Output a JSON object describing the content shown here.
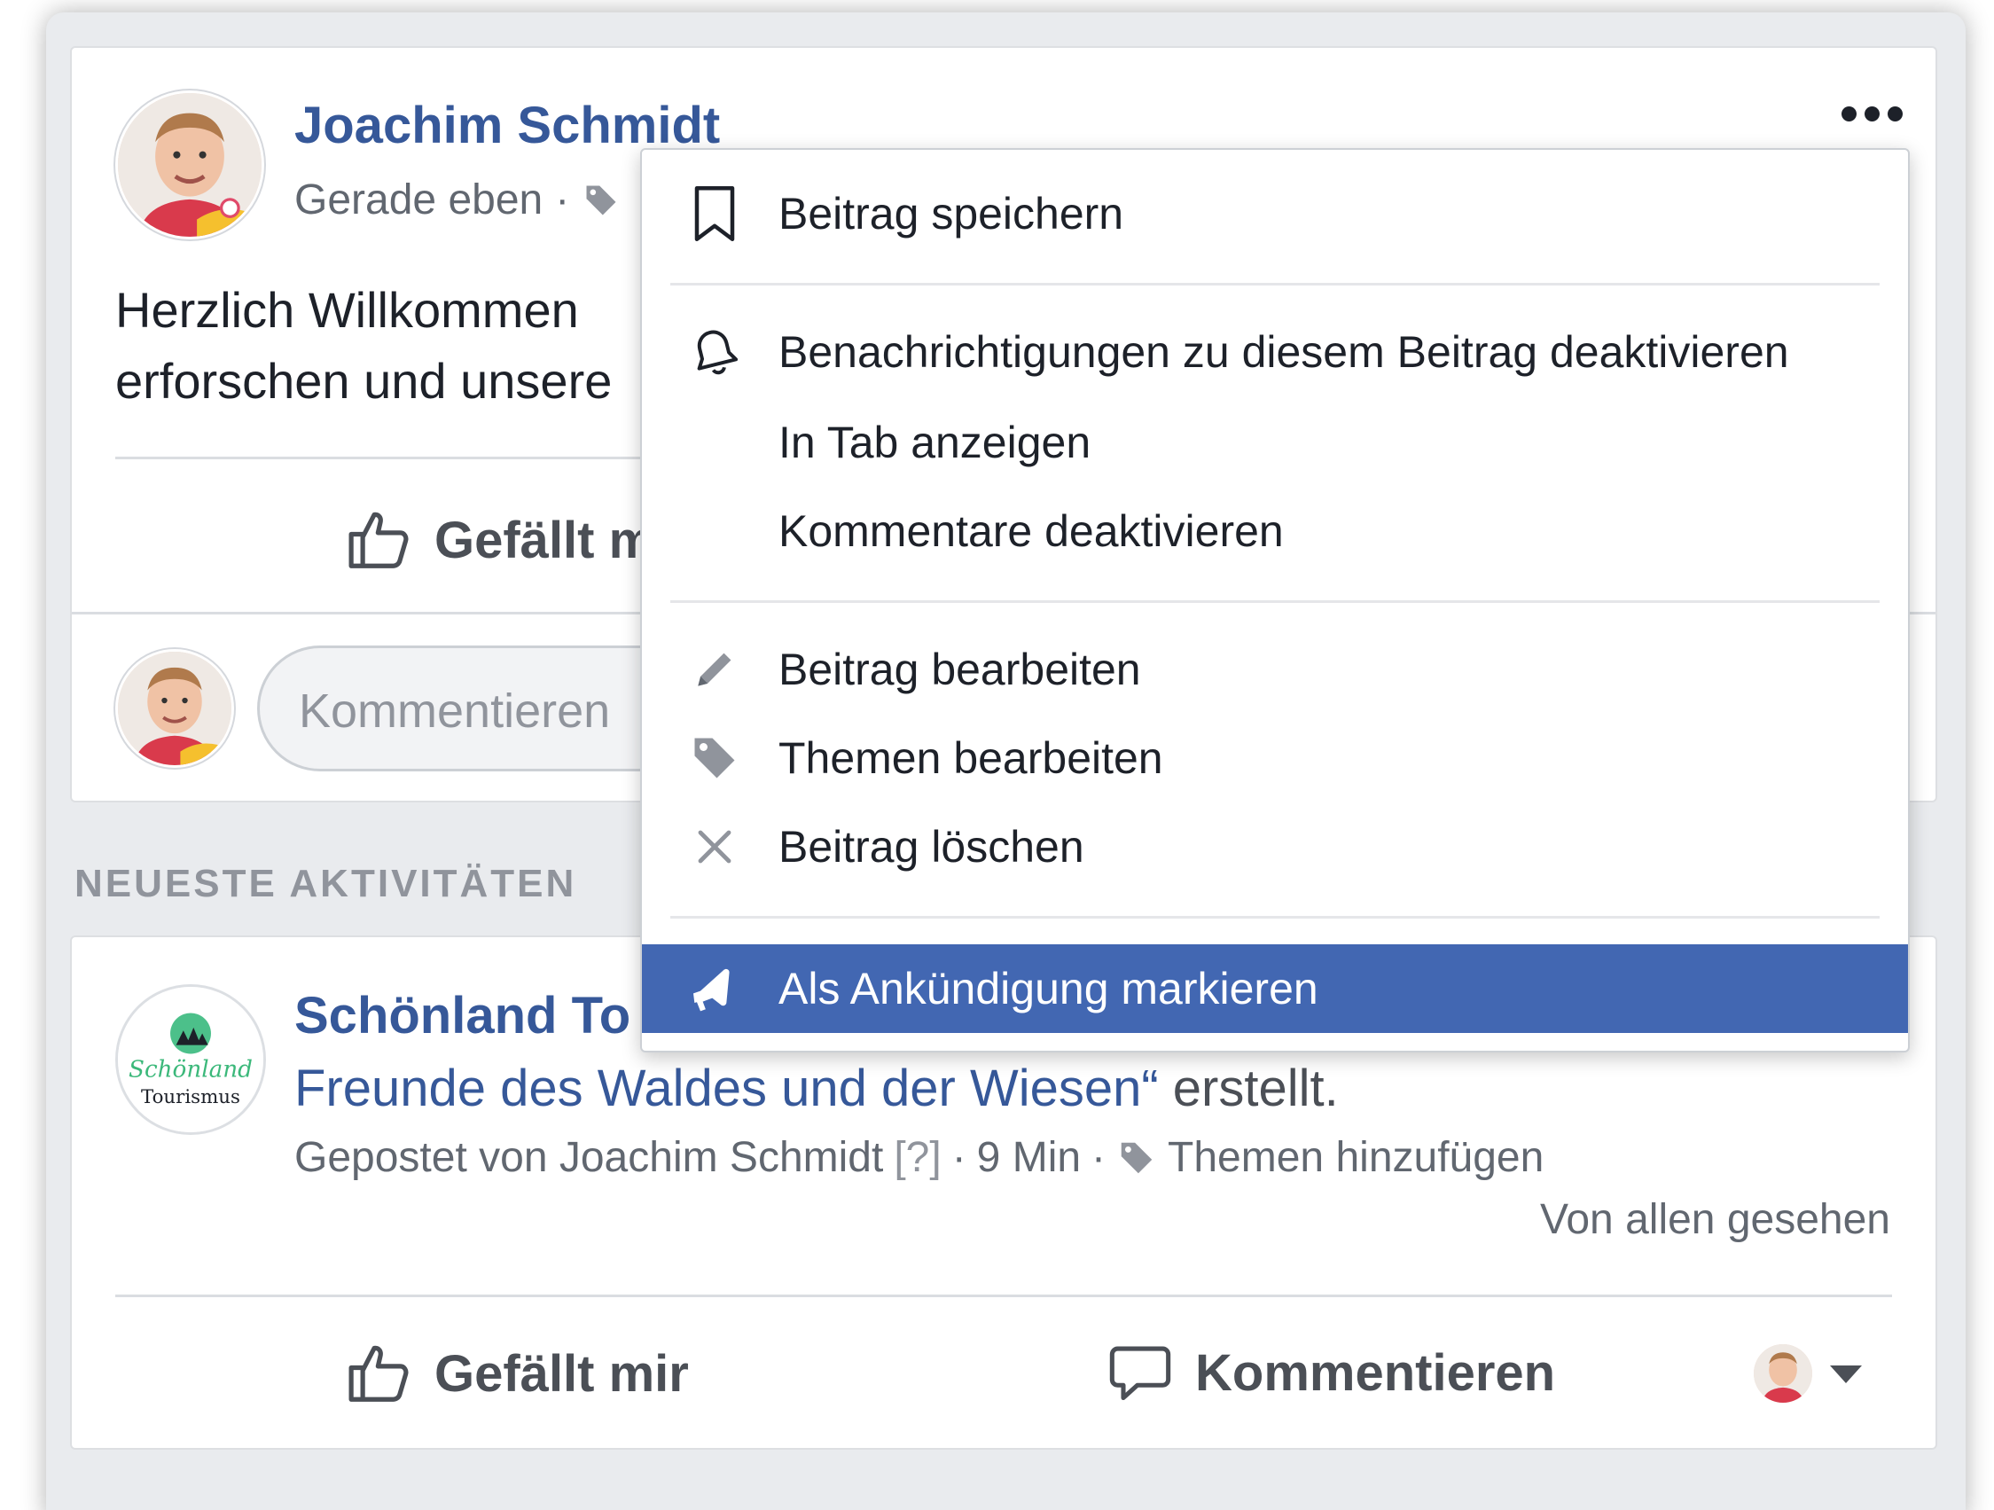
{
  "post": {
    "author": "Joachim Schmidt",
    "time": "Gerade eben",
    "separator": "·",
    "text": "Herzlich Willkommen \nerforschen und unsere",
    "like_label": "Gefällt m",
    "comment_placeholder": "Kommentieren",
    "more_icon": "more-dots-icon"
  },
  "section": {
    "title": "NEUESTE AKTIVITÄTEN"
  },
  "activity": {
    "page_name": "Schönland To",
    "group_link": "Freunde des Waldes und der Wiesen“",
    "group_suffix": " erstellt.",
    "posted_by": "Gepostet von Joachim Schmidt",
    "help": "[?]",
    "time_sep": "·",
    "time": "9 Min",
    "tag_sep": "·",
    "add_topics": "Themen hinzufügen",
    "seen": "Von allen gesehen",
    "like_label": "Gefällt mir",
    "comment_label": "Kommentieren",
    "logo_text_1": "Schönland",
    "logo_text_2": "Tourismus"
  },
  "menu": {
    "items": [
      {
        "label": "Beitrag speichern",
        "icon": "bookmark-icon"
      },
      {
        "label": "Benachrichtigungen zu diesem Beitrag deaktivieren",
        "icon": "bell-icon"
      },
      {
        "label": "In Tab anzeigen",
        "icon": ""
      },
      {
        "label": "Kommentare deaktivieren",
        "icon": ""
      },
      {
        "label": "Beitrag bearbeiten",
        "icon": "pencil-icon"
      },
      {
        "label": "Themen bearbeiten",
        "icon": "tag-icon"
      },
      {
        "label": "Beitrag löschen",
        "icon": "close-icon"
      },
      {
        "label": "Als Ankündigung markieren",
        "icon": "megaphone-icon",
        "active": true
      }
    ]
  },
  "colors": {
    "accent": "#4267b2",
    "link": "#365899",
    "background": "#e9ebee"
  }
}
